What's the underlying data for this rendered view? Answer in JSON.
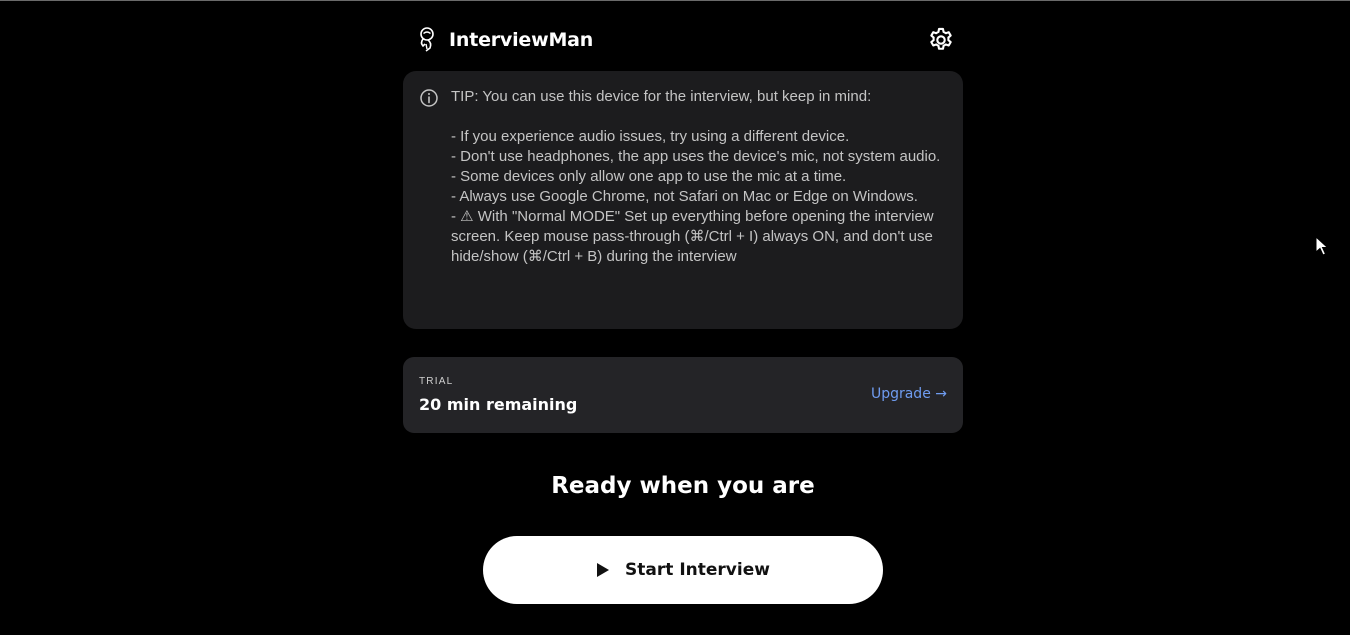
{
  "app": {
    "name": "InterviewMan",
    "logo_icon": "astronaut-logo-icon",
    "settings_icon": "gear-icon"
  },
  "tip": {
    "icon": "info-icon",
    "text": "TIP: You can use this device for the interview, but keep in mind:\n\n- If you experience audio issues, try using a different device.\n- Don't use headphones, the app uses the device's mic, not system audio.\n- Some devices only allow one app to use the mic at a time.\n- Always use Google Chrome, not Safari on Mac or Edge on Windows.\n- ⚠ With \"Normal MODE\" Set up everything before opening the interview screen. Keep mouse pass-through (⌘/Ctrl + I) always ON, and don't use hide/show (⌘/Ctrl + B) during the interview"
  },
  "trial": {
    "label": "TRIAL",
    "remaining": "20 min remaining",
    "upgrade_label": "Upgrade →"
  },
  "main": {
    "heading": "Ready when you are",
    "start_label": "Start Interview",
    "start_icon": "play-icon"
  },
  "colors": {
    "background": "#000000",
    "card": "#1c1c1e",
    "trial_card": "#242427",
    "accent_link": "#6f9cf0",
    "button": "#ffffff"
  }
}
